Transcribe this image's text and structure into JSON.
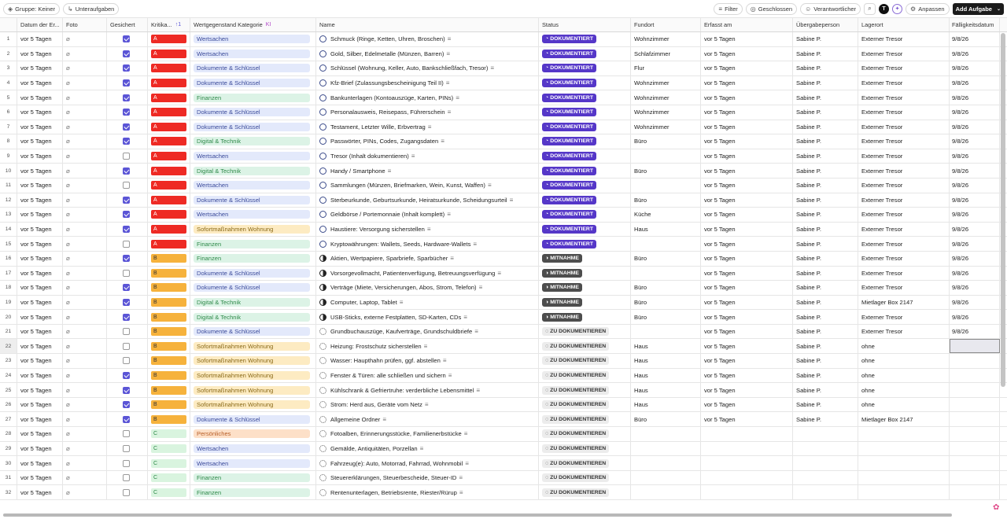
{
  "toolbar": {
    "left_buttons": [
      "Gruppe: Keiner",
      "Unteraufgaben"
    ],
    "right_buttons": [
      "Filter",
      "Geschlossen",
      "Verantwortlicher"
    ],
    "avatar_letter": "T",
    "customize_label": "Anpassen",
    "add_task_label": "Add Aufgabe"
  },
  "columns": {
    "date": "Datum der Er...",
    "photo": "Foto",
    "secured": "Gesichert",
    "criticality": "Kritika...",
    "criticality_sort": "↑1",
    "category": "Wertgegenstand Kategorie",
    "category_tag": "KI",
    "name": "Name",
    "status": "Status",
    "location": "Fundort",
    "captured": "Erfasst am",
    "handover": "Übergabeperson",
    "storage": "Lagerort",
    "due": "Fälligkeitsdatum"
  },
  "category_colors": {
    "Wertsachen": "#e3e9fb",
    "Dokumente & Schlüssel": "#e3e9fb",
    "Finanzen": "#dcf3e6",
    "Digital & Technik": "#dcf3e6",
    "Sofortmaßnahmen Wohnung": "#fdebc2",
    "Persönliches": "#fde0c8"
  },
  "status_labels": {
    "D": "DOKUMENTIERT",
    "M": "MITNAHME",
    "Z": "ZU DOKUMENTIEREN"
  },
  "rows": [
    {
      "n": "1",
      "date": "vor 5 Tagen",
      "sec": true,
      "k": "A",
      "cat": "Wertsachen",
      "name": "Schmuck (Ringe, Ketten, Uhren, Broschen)",
      "st": "D",
      "loc": "Wohnzimmer",
      "cap": "vor 5 Tagen",
      "person": "Sabine P.",
      "store": "Externer Tresor",
      "due": "9/8/26"
    },
    {
      "n": "2",
      "date": "vor 5 Tagen",
      "sec": true,
      "k": "A",
      "cat": "Wertsachen",
      "name": "Gold, Silber, Edelmetalle (Münzen, Barren)",
      "st": "D",
      "loc": "Schlafzimmer",
      "cap": "vor 5 Tagen",
      "person": "Sabine P.",
      "store": "Externer Tresor",
      "due": "9/8/26"
    },
    {
      "n": "3",
      "date": "vor 5 Tagen",
      "sec": true,
      "k": "A",
      "cat": "Dokumente & Schlüssel",
      "name": "Schlüssel (Wohnung, Keller, Auto, Bankschließfach, Tresor)",
      "st": "D",
      "loc": "Flur",
      "cap": "vor 5 Tagen",
      "person": "Sabine P.",
      "store": "Externer Tresor",
      "due": "9/8/26"
    },
    {
      "n": "4",
      "date": "vor 5 Tagen",
      "sec": true,
      "k": "A",
      "cat": "Dokumente & Schlüssel",
      "name": "Kfz-Brief (Zulassungsbescheinigung Teil II)",
      "st": "D",
      "loc": "Wohnzimmer",
      "cap": "vor 5 Tagen",
      "person": "Sabine P.",
      "store": "Externer Tresor",
      "due": "9/8/26"
    },
    {
      "n": "5",
      "date": "vor 5 Tagen",
      "sec": true,
      "k": "A",
      "cat": "Finanzen",
      "name": "Bankunterlagen (Kontoauszüge, Karten, PINs)",
      "st": "D",
      "loc": "Wohnzimmer",
      "cap": "vor 5 Tagen",
      "person": "Sabine P.",
      "store": "Externer Tresor",
      "due": "9/8/26"
    },
    {
      "n": "6",
      "date": "vor 5 Tagen",
      "sec": true,
      "k": "A",
      "cat": "Dokumente & Schlüssel",
      "name": "Personalausweis, Reisepass, Führerschein",
      "st": "D",
      "loc": "Wohnzimmer",
      "cap": "vor 5 Tagen",
      "person": "Sabine P.",
      "store": "Externer Tresor",
      "due": "9/8/26"
    },
    {
      "n": "7",
      "date": "vor 5 Tagen",
      "sec": true,
      "k": "A",
      "cat": "Dokumente & Schlüssel",
      "name": "Testament, Letzter Wille, Erbvertrag",
      "st": "D",
      "loc": "Wohnzimmer",
      "cap": "vor 5 Tagen",
      "person": "Sabine P.",
      "store": "Externer Tresor",
      "due": "9/8/26"
    },
    {
      "n": "8",
      "date": "vor 5 Tagen",
      "sec": true,
      "k": "A",
      "cat": "Digital & Technik",
      "name": "Passwörter, PINs, Codes, Zugangsdaten",
      "st": "D",
      "loc": "Büro",
      "cap": "vor 5 Tagen",
      "person": "Sabine P.",
      "store": "Externer Tresor",
      "due": "9/8/26"
    },
    {
      "n": "9",
      "date": "vor 5 Tagen",
      "sec": false,
      "k": "A",
      "cat": "Wertsachen",
      "name": "Tresor (Inhalt dokumentieren)",
      "st": "D",
      "loc": "",
      "cap": "vor 5 Tagen",
      "person": "Sabine P.",
      "store": "Externer Tresor",
      "due": "9/8/26"
    },
    {
      "n": "10",
      "date": "vor 5 Tagen",
      "sec": true,
      "k": "A",
      "cat": "Digital & Technik",
      "name": "Handy / Smartphone",
      "st": "D",
      "loc": "Büro",
      "cap": "vor 5 Tagen",
      "person": "Sabine P.",
      "store": "Externer Tresor",
      "due": "9/8/26"
    },
    {
      "n": "11",
      "date": "vor 5 Tagen",
      "sec": false,
      "k": "A",
      "cat": "Wertsachen",
      "name": "Sammlungen (Münzen, Briefmarken, Wein, Kunst, Waffen)",
      "st": "D",
      "loc": "",
      "cap": "vor 5 Tagen",
      "person": "Sabine P.",
      "store": "Externer Tresor",
      "due": "9/8/26"
    },
    {
      "n": "12",
      "date": "vor 5 Tagen",
      "sec": true,
      "k": "A",
      "cat": "Dokumente & Schlüssel",
      "name": "Sterbeurkunde, Geburtsurkunde, Heiratsurkunde, Scheidungsurteil",
      "st": "D",
      "loc": "Büro",
      "cap": "vor 5 Tagen",
      "person": "Sabine P.",
      "store": "Externer Tresor",
      "due": "9/8/26"
    },
    {
      "n": "13",
      "date": "vor 5 Tagen",
      "sec": true,
      "k": "A",
      "cat": "Wertsachen",
      "name": "Geldbörse / Portemonnaie (Inhalt komplett)",
      "st": "D",
      "loc": "Küche",
      "cap": "vor 5 Tagen",
      "person": "Sabine P.",
      "store": "Externer Tresor",
      "due": "9/8/26"
    },
    {
      "n": "14",
      "date": "vor 5 Tagen",
      "sec": true,
      "k": "A",
      "cat": "Sofortmaßnahmen Wohnung",
      "name": "Haustiere: Versorgung sicherstellen",
      "st": "D",
      "loc": "Haus",
      "cap": "vor 5 Tagen",
      "person": "Sabine P.",
      "store": "Externer Tresor",
      "due": "9/8/26"
    },
    {
      "n": "15",
      "date": "vor 5 Tagen",
      "sec": false,
      "k": "A",
      "cat": "Finanzen",
      "name": "Kryptowährungen: Wallets, Seeds, Hardware-Wallets",
      "st": "D",
      "loc": "",
      "cap": "vor 5 Tagen",
      "person": "Sabine P.",
      "store": "Externer Tresor",
      "due": "9/8/26"
    },
    {
      "n": "16",
      "date": "vor 5 Tagen",
      "sec": true,
      "k": "B",
      "cat": "Finanzen",
      "name": "Aktien, Wertpapiere, Sparbriefe, Sparbücher",
      "st": "M",
      "loc": "Büro",
      "cap": "vor 5 Tagen",
      "person": "Sabine P.",
      "store": "Externer Tresor",
      "due": "9/8/26"
    },
    {
      "n": "17",
      "date": "vor 5 Tagen",
      "sec": false,
      "k": "B",
      "cat": "Dokumente & Schlüssel",
      "name": "Vorsorgevollmacht, Patientenverfügung, Betreuungsverfügung",
      "st": "M",
      "loc": "",
      "cap": "vor 5 Tagen",
      "person": "Sabine P.",
      "store": "Externer Tresor",
      "due": "9/8/26"
    },
    {
      "n": "18",
      "date": "vor 5 Tagen",
      "sec": true,
      "k": "B",
      "cat": "Dokumente & Schlüssel",
      "name": "Verträge (Miete, Versicherungen, Abos, Strom, Telefon)",
      "st": "M",
      "loc": "Büro",
      "cap": "vor 5 Tagen",
      "person": "Sabine P.",
      "store": "Externer Tresor",
      "due": "9/8/26"
    },
    {
      "n": "19",
      "date": "vor 5 Tagen",
      "sec": true,
      "k": "B",
      "cat": "Digital & Technik",
      "name": "Computer, Laptop, Tablet",
      "st": "M",
      "loc": "Büro",
      "cap": "vor 5 Tagen",
      "person": "Sabine P.",
      "store": "Mietlager Box 2147",
      "due": "9/8/26"
    },
    {
      "n": "20",
      "date": "vor 5 Tagen",
      "sec": true,
      "k": "B",
      "cat": "Digital & Technik",
      "name": "USB-Sticks, externe Festplatten, SD-Karten, CDs",
      "st": "M",
      "loc": "Büro",
      "cap": "vor 5 Tagen",
      "person": "Sabine P.",
      "store": "Externer Tresor",
      "due": "9/8/26"
    },
    {
      "n": "21",
      "date": "vor 5 Tagen",
      "sec": false,
      "k": "B",
      "cat": "Dokumente & Schlüssel",
      "name": "Grundbuchauszüge, Kaufverträge, Grundschuldbriefe",
      "st": "Z",
      "loc": "",
      "cap": "vor 5 Tagen",
      "person": "Sabine P.",
      "store": "Externer Tresor",
      "due": "9/8/26"
    },
    {
      "n": "22",
      "date": "vor 5 Tagen",
      "sec": false,
      "k": "B",
      "cat": "Sofortmaßnahmen Wohnung",
      "name": "Heizung: Frostschutz sicherstellen",
      "st": "Z",
      "loc": "Haus",
      "cap": "vor 5 Tagen",
      "person": "Sabine P.",
      "store": "ohne",
      "due": ""
    },
    {
      "n": "23",
      "date": "vor 5 Tagen",
      "sec": false,
      "k": "B",
      "cat": "Sofortmaßnahmen Wohnung",
      "name": "Wasser: Haupthahn prüfen, ggf. abstellen",
      "st": "Z",
      "loc": "Haus",
      "cap": "vor 5 Tagen",
      "person": "Sabine P.",
      "store": "ohne",
      "due": ""
    },
    {
      "n": "24",
      "date": "vor 5 Tagen",
      "sec": true,
      "k": "B",
      "cat": "Sofortmaßnahmen Wohnung",
      "name": "Fenster & Türen: alle schließen und sichern",
      "st": "Z",
      "loc": "Haus",
      "cap": "vor 5 Tagen",
      "person": "Sabine P.",
      "store": "ohne",
      "due": ""
    },
    {
      "n": "25",
      "date": "vor 5 Tagen",
      "sec": true,
      "k": "B",
      "cat": "Sofortmaßnahmen Wohnung",
      "name": "Kühlschrank & Gefriertruhe: verderbliche Lebensmittel",
      "st": "Z",
      "loc": "Haus",
      "cap": "vor 5 Tagen",
      "person": "Sabine P.",
      "store": "ohne",
      "due": ""
    },
    {
      "n": "26",
      "date": "vor 5 Tagen",
      "sec": true,
      "k": "B",
      "cat": "Sofortmaßnahmen Wohnung",
      "name": "Strom: Herd aus, Geräte vom Netz",
      "st": "Z",
      "loc": "Haus",
      "cap": "vor 5 Tagen",
      "person": "Sabine P.",
      "store": "ohne",
      "due": ""
    },
    {
      "n": "27",
      "date": "vor 5 Tagen",
      "sec": true,
      "k": "B",
      "cat": "Dokumente & Schlüssel",
      "name": "Allgemeine Ordner",
      "st": "Z",
      "loc": "Büro",
      "cap": "vor 5 Tagen",
      "person": "Sabine P.",
      "store": "Mietlager Box 2147",
      "due": ""
    },
    {
      "n": "28",
      "date": "vor 5 Tagen",
      "sec": false,
      "k": "C",
      "cat": "Persönliches",
      "name": "Fotoalben, Erinnerungsstücke, Familienerbstücke",
      "st": "Z",
      "loc": "",
      "cap": "",
      "person": "",
      "store": "",
      "due": ""
    },
    {
      "n": "29",
      "date": "vor 5 Tagen",
      "sec": false,
      "k": "C",
      "cat": "Wertsachen",
      "name": "Gemälde, Antiquitäten, Porzellan",
      "st": "Z",
      "loc": "",
      "cap": "",
      "person": "",
      "store": "",
      "due": ""
    },
    {
      "n": "30",
      "date": "vor 5 Tagen",
      "sec": false,
      "k": "C",
      "cat": "Wertsachen",
      "name": "Fahrzeug(e): Auto, Motorrad, Fahrrad, Wohnmobil",
      "st": "Z",
      "loc": "",
      "cap": "",
      "person": "",
      "store": "",
      "due": ""
    },
    {
      "n": "31",
      "date": "vor 5 Tagen",
      "sec": false,
      "k": "C",
      "cat": "Finanzen",
      "name": "Steuererklärungen, Steuerbescheide, Steuer-ID",
      "st": "Z",
      "loc": "",
      "cap": "",
      "person": "",
      "store": "",
      "due": ""
    },
    {
      "n": "32",
      "date": "vor 5 Tagen",
      "sec": false,
      "k": "C",
      "cat": "Finanzen",
      "name": "Rentenunterlagen, Betriebsrente, Riester/Rürup",
      "st": "Z",
      "loc": "",
      "cap": "",
      "person": "",
      "store": "",
      "due": ""
    }
  ]
}
